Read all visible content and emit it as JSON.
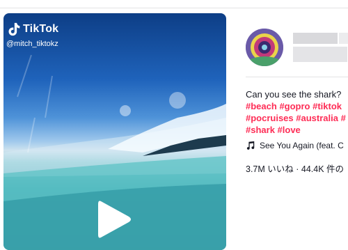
{
  "video": {
    "brand": "TikTok",
    "handle": "@mitch_tiktokz",
    "icons": {
      "logo": "tiktok-note-icon",
      "play": "play-icon"
    }
  },
  "panel": {
    "caption": "Can you see the shark?",
    "hashtags_line1": [
      "#beach",
      "#gopro",
      "#tiktok"
    ],
    "hashtags_line2": [
      "#pocruises",
      "#australia",
      "#"
    ],
    "hashtags_line3": [
      "#shark",
      "#love"
    ],
    "music": {
      "icon": "music-note-icon",
      "title": "See You Again (feat. C"
    },
    "stats": "3.7M いいね · 44.4K 件の"
  },
  "colors": {
    "hashtag": "#fe2c55",
    "text": "#161823"
  }
}
